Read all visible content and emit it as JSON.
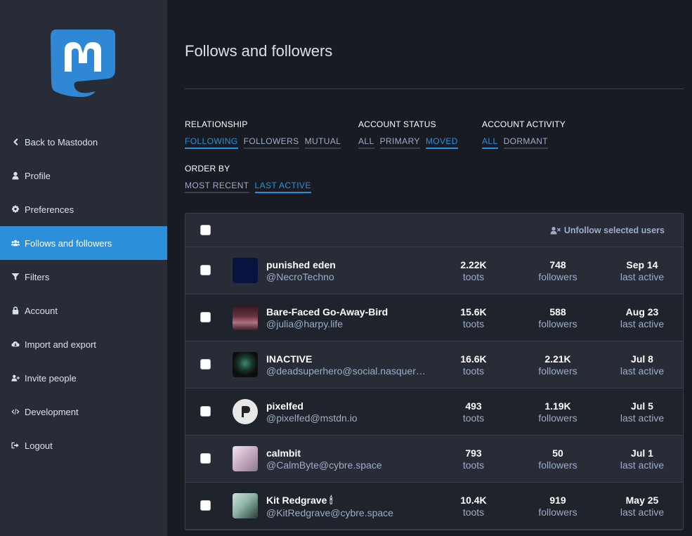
{
  "sidebar": {
    "logo_icon": "mastodon-logo",
    "items": [
      {
        "label": "Back to Mastodon",
        "icon": "chevron-left-icon"
      },
      {
        "label": "Profile",
        "icon": "user-icon"
      },
      {
        "label": "Preferences",
        "icon": "cog-icon"
      },
      {
        "label": "Follows and followers",
        "icon": "users-icon",
        "active": true
      },
      {
        "label": "Filters",
        "icon": "filter-icon"
      },
      {
        "label": "Account",
        "icon": "lock-icon"
      },
      {
        "label": "Import and export",
        "icon": "cloud-download-icon"
      },
      {
        "label": "Invite people",
        "icon": "user-plus-icon"
      },
      {
        "label": "Development",
        "icon": "code-icon"
      },
      {
        "label": "Logout",
        "icon": "sign-out-icon"
      }
    ]
  },
  "page": {
    "title": "Follows and followers"
  },
  "filters": {
    "relationship": {
      "label": "RELATIONSHIP",
      "options": [
        "FOLLOWING",
        "FOLLOWERS",
        "MUTUAL"
      ],
      "selected": "FOLLOWING"
    },
    "status": {
      "label": "ACCOUNT STATUS",
      "options": [
        "ALL",
        "PRIMARY",
        "MOVED"
      ],
      "selected": "MOVED"
    },
    "activity": {
      "label": "ACCOUNT ACTIVITY",
      "options": [
        "ALL",
        "DORMANT"
      ],
      "selected": "ALL"
    },
    "order": {
      "label": "ORDER BY",
      "options": [
        "MOST RECENT",
        "LAST ACTIVE"
      ],
      "selected": "LAST ACTIVE"
    }
  },
  "table": {
    "unfollow_label": "Unfollow selected users",
    "rows": [
      {
        "name": "punished eden",
        "acct": "@NecroTechno",
        "toots": "2.22K",
        "toots_label": "toots",
        "followers": "748",
        "followers_label": "followers",
        "last": "Sep 14",
        "last_label": "last active",
        "avatar_color": "#0a1240"
      },
      {
        "name": "Bare-Faced Go-Away-Bird",
        "acct": "@julia@harpy.life",
        "toots": "15.6K",
        "toots_label": "toots",
        "followers": "588",
        "followers_label": "followers",
        "last": "Aug 23",
        "last_label": "last active",
        "avatar_color": "#5a2a35"
      },
      {
        "name": "INACTIVE",
        "acct": "@deadsuperhero@social.nasqueron.org",
        "toots": "16.6K",
        "toots_label": "toots",
        "followers": "2.21K",
        "followers_label": "followers",
        "last": "Jul 8",
        "last_label": "last active",
        "avatar_color": "#0d0f0e"
      },
      {
        "name": "pixelfed",
        "acct": "@pixelfed@mstdn.io",
        "toots": "493",
        "toots_label": "toots",
        "followers": "1.19K",
        "followers_label": "followers",
        "last": "Jul 5",
        "last_label": "last active",
        "avatar_color": "#e8e8e8"
      },
      {
        "name": "calmbit",
        "acct": "@CalmByte@cybre.space",
        "toots": "793",
        "toots_label": "toots",
        "followers": "50",
        "followers_label": "followers",
        "last": "Jul 1",
        "last_label": "last active",
        "avatar_color": "#d8c8d8"
      },
      {
        "name": "Kit Redgrave 🕯",
        "acct": "@KitRedgrave@cybre.space",
        "toots": "10.4K",
        "toots_label": "toots",
        "followers": "919",
        "followers_label": "followers",
        "last": "May 25",
        "last_label": "last active",
        "avatar_color": "#8fb5a8"
      }
    ]
  }
}
